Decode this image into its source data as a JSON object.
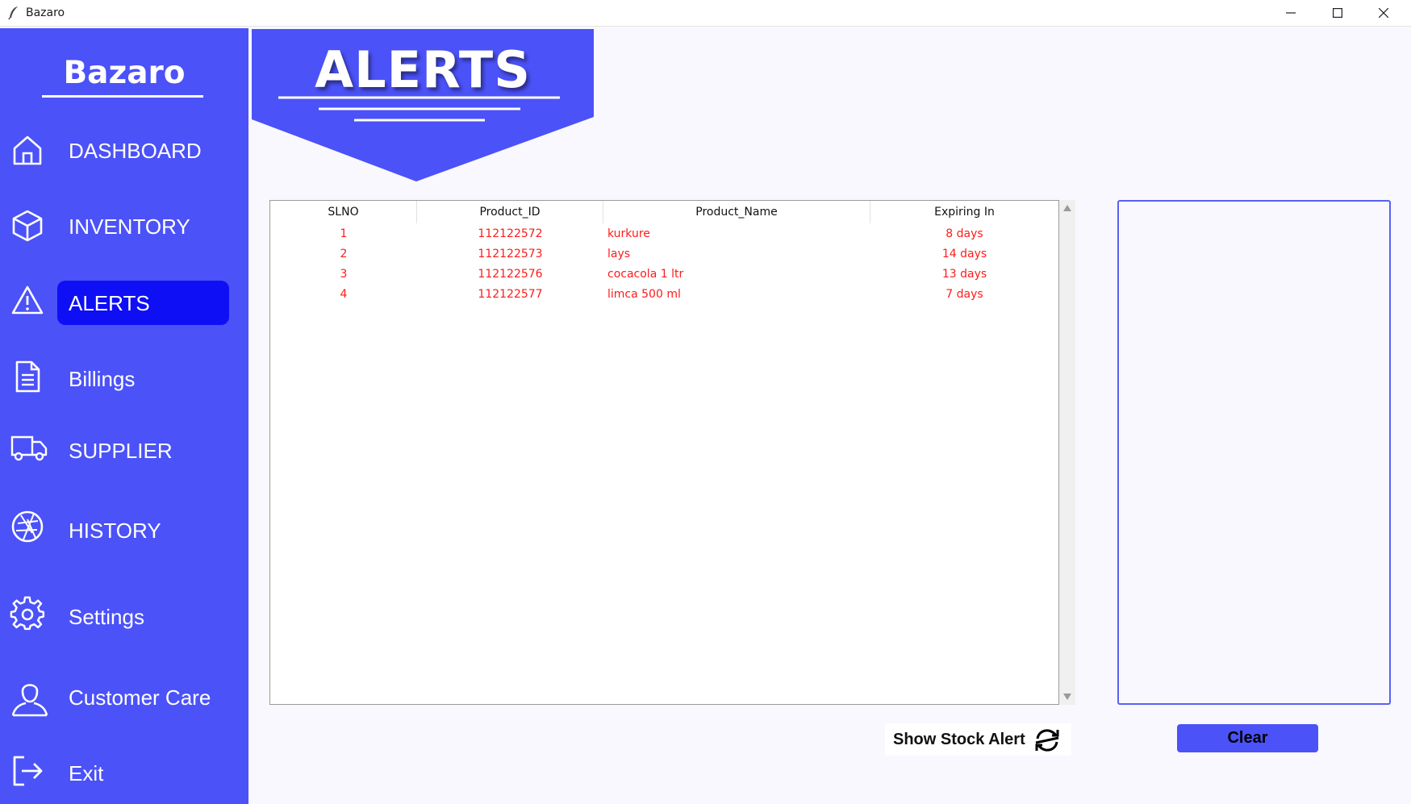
{
  "window": {
    "title": "Bazaro",
    "app_icon": "feather-icon",
    "controls": [
      "minimize-icon",
      "maximize-icon",
      "close-icon"
    ]
  },
  "sidebar": {
    "brand": "Bazaro",
    "background": "#4b52f8",
    "active_item": "ALERTS",
    "active_color": "#0f0ff5",
    "items": [
      {
        "label": "DASHBOARD",
        "icon": "home-icon"
      },
      {
        "label": "INVENTORY",
        "icon": "box-icon"
      },
      {
        "label": "ALERTS",
        "icon": "warning-icon"
      },
      {
        "label": "Billings",
        "icon": "document-icon"
      },
      {
        "label": "SUPPLIER",
        "icon": "truck-icon"
      },
      {
        "label": "HISTORY",
        "icon": "aperture-icon"
      },
      {
        "label": "Settings",
        "icon": "gear-icon"
      },
      {
        "label": "Customer Care",
        "icon": "person-icon"
      },
      {
        "label": "Exit",
        "icon": "exit-icon"
      }
    ]
  },
  "header": {
    "title": "ALERTS"
  },
  "table": {
    "columns": [
      "SLNO",
      "Product_ID",
      "Product_Name",
      "Expiring In"
    ],
    "rows": [
      {
        "slno": "1",
        "product_id": "112122572",
        "product_name": "kurkure",
        "expiring_in": "8 days"
      },
      {
        "slno": "2",
        "product_id": "112122573",
        "product_name": "lays",
        "expiring_in": "14 days"
      },
      {
        "slno": "3",
        "product_id": "112122576",
        "product_name": "cocacola 1 ltr",
        "expiring_in": "13 days"
      },
      {
        "slno": "4",
        "product_id": "112122577",
        "product_name": "limca 500 ml",
        "expiring_in": "7 days"
      }
    ],
    "row_text_color": "#ff1a1a"
  },
  "actions": {
    "show_stock_alert_label": "Show Stock Alert",
    "show_stock_alert_icon": "refresh-icon",
    "clear_label": "Clear"
  }
}
